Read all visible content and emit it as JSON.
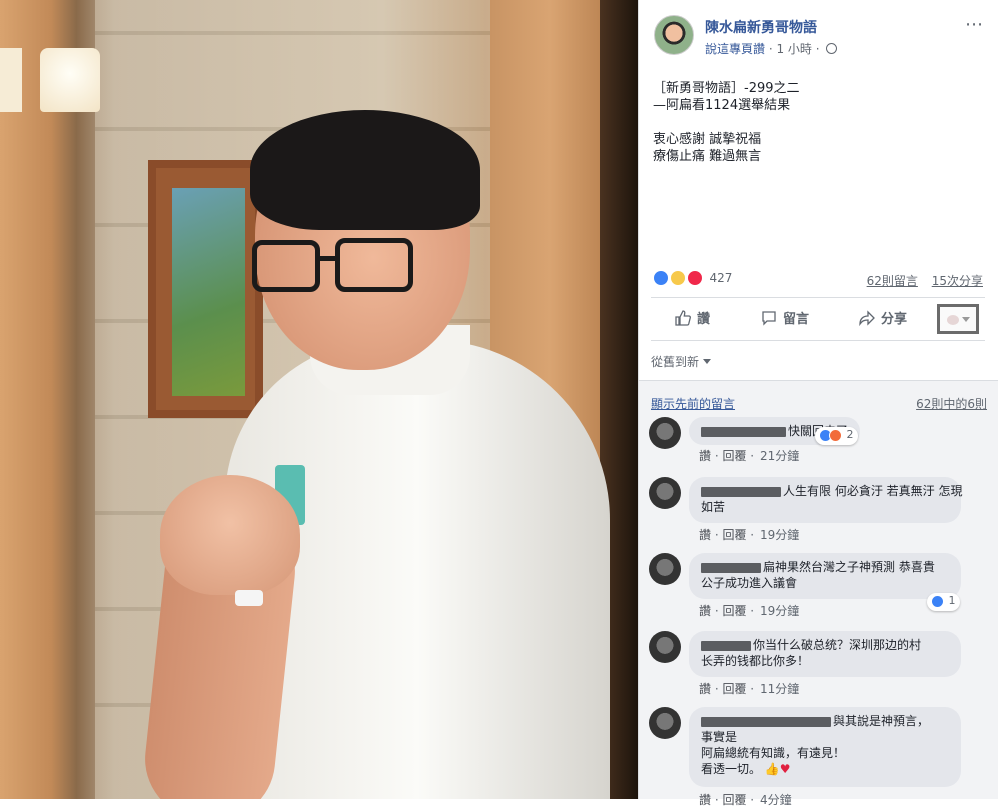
{
  "post": {
    "page_name": "陳水扁新勇哥物語",
    "like_page_label": "說這專頁讚",
    "time": "1 小時",
    "text_line1": "［新勇哥物語］-299之二",
    "text_line2": "—阿扁看1124選舉結果",
    "text_line3": "衷心感謝 誠摯祝福",
    "text_line4": "療傷止痛 難過無言",
    "reaction_count": "427",
    "comments_count": "62則留言",
    "shares_count": "15次分享",
    "actions": {
      "like": "讚",
      "comment": "留言",
      "share": "分享"
    },
    "more_icon": "⋯"
  },
  "comments_section": {
    "sort_label": "從舊到新",
    "show_previous": "顯示先前的留言",
    "count_label": "62則中的6則",
    "comments": [
      {
        "text": "快關回去了",
        "reply_like": "讚",
        "reply": "回覆",
        "time": "21分鐘",
        "reaction_count": "2"
      },
      {
        "text": "人生有限 何必貪汙 若真無汙 怎現\n如苦",
        "reply_like": "讚",
        "reply": "回覆",
        "time": "19分鐘"
      },
      {
        "text": "扁神果然台灣之子神預測 恭喜貴\n公子成功進入議會",
        "reply_like": "讚",
        "reply": "回覆",
        "time": "19分鐘",
        "reaction_count": "1"
      },
      {
        "text": "你当什么破总统？深圳那边的村\n长弄的钱都比你多！",
        "reply_like": "讚",
        "reply": "回覆",
        "time": "11分鐘"
      },
      {
        "text": "與其說是神預言，\n事實是\n阿扁總統有知識，有遠見！\n看透一切。",
        "reply_like": "讚",
        "reply": "回覆",
        "time": "4分鐘"
      }
    ]
  },
  "colors": {
    "link": "#365899",
    "like_blue": "#3b82f6",
    "love_red": "#f0284a",
    "bubble": "#e4e6eb"
  }
}
